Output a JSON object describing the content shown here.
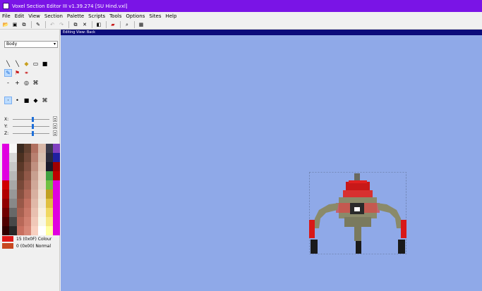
{
  "window": {
    "title": "Voxel Section Editor III v1.39.274 [SU Hind.vxl]"
  },
  "menu": [
    "File",
    "Edit",
    "View",
    "Section",
    "Palette",
    "Scripts",
    "Tools",
    "Options",
    "Sites",
    "Help"
  ],
  "left_panel": {
    "section_select_value": "Body",
    "axes": [
      {
        "label": "X:",
        "value": 0.52
      },
      {
        "label": "Y:",
        "value": 0.52
      },
      {
        "label": "Z:",
        "value": 0.52
      }
    ],
    "color_left": {
      "swatch": "#e01818",
      "text": "15 (0x0F)  Colour"
    },
    "color_right": {
      "swatch": "#c84820",
      "text": "0 (0x00)  Normal"
    }
  },
  "viewport": {
    "header": "Editing View: Back",
    "bg_color": "#8fa9e8"
  },
  "colors": {
    "title_bar": "#7a14e6",
    "view_header": "#0c0c7a",
    "accent": "#1e6fd9"
  },
  "icons": {
    "toolbar": [
      "open-icon",
      "save-icon",
      "save-as-icon",
      "export-icon",
      "undo-icon",
      "redo-icon",
      "copy-icon",
      "cut-icon",
      "layer-icon",
      "car-icon",
      "search-icon",
      "palette-icon"
    ],
    "tools": [
      "line-icon",
      "brush-icon",
      "eraser-icon",
      "rect-icon",
      "fill-rect-icon",
      "picker-icon",
      "replace-icon",
      "flood-icon",
      "zoom-out-icon",
      "zoom-in-icon",
      "smooth-icon",
      "pattern-icon"
    ],
    "brush_shapes": [
      "point-icon",
      "dot-icon",
      "square-icon",
      "diamond-icon",
      "custom-brush-icon"
    ]
  }
}
